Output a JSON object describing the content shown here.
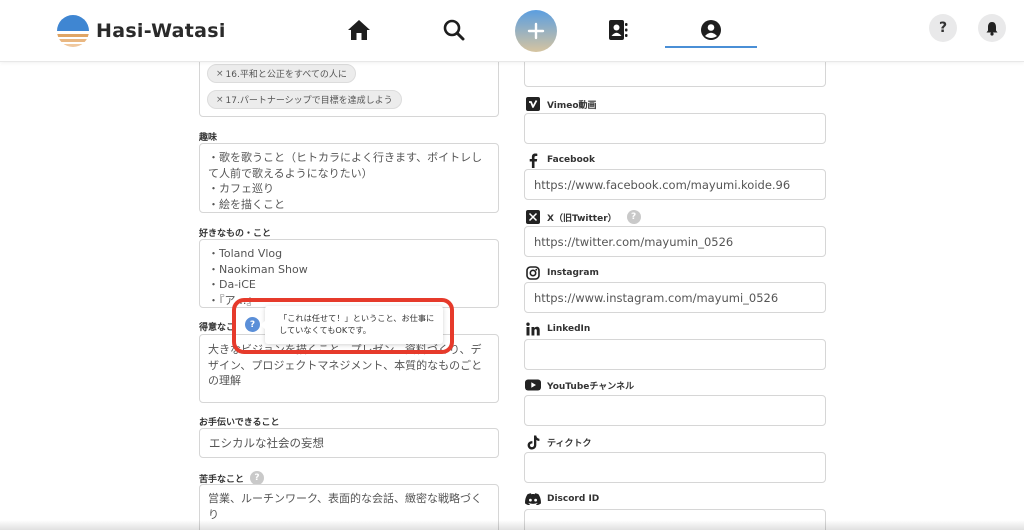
{
  "app": {
    "logo_text": "Hasi-Watasi"
  },
  "header": {
    "help_label": "?"
  },
  "tags": [
    "16.平和と公正をすべての人に",
    "17.パートナーシップで目標を達成しよう"
  ],
  "fields": {
    "hobby": {
      "label": "趣味",
      "value": "・歌を歌うこと（ヒトカラによく行きます、ボイトレして人前で歌えるようになりたい）\n・カフェ巡り\n・絵を描くこと"
    },
    "likes": {
      "label": "好きなもの・こと",
      "value": "・Toland Vlog\n・Naokiman Show\n・Da-iCE\n・『ア…』"
    },
    "good_at": {
      "label": "得意なこ",
      "value": "大きなビジョンを描くこと、プレゼン、資料づくり、デザイン、プロジェクトマネジメント、本質的なものごとの理解"
    },
    "can_help": {
      "label": "お手伝いできること",
      "value": "エシカルな社会の妄想"
    },
    "weak_at": {
      "label": "苦手なこと",
      "value": "営業、ルーチンワーク、表面的な会話、緻密な戦略づくり"
    }
  },
  "tooltip": {
    "icon": "?",
    "text": "「これは任せて！」ということ、お仕事にしていなくてもOKです。"
  },
  "social": {
    "vimeo": {
      "label": "Vimeo動画",
      "value": ""
    },
    "facebook": {
      "label": "Facebook",
      "value": "https://www.facebook.com/mayumi.koide.96"
    },
    "twitter": {
      "label": "X（旧Twitter）",
      "value": "https://twitter.com/mayumin_0526"
    },
    "instagram": {
      "label": "Instagram",
      "value": "https://www.instagram.com/mayumi_0526"
    },
    "linkedin": {
      "label": "LinkedIn",
      "value": ""
    },
    "youtube": {
      "label": "YouTubeチャンネル",
      "value": ""
    },
    "tiktok": {
      "label": "ティクトク",
      "value": ""
    },
    "discord": {
      "label": "Discord ID",
      "value": ""
    }
  },
  "colors": {
    "accent": "#4a8fd6",
    "highlight": "#e63a2b",
    "tooltip_icon": "#5b8fd8"
  }
}
